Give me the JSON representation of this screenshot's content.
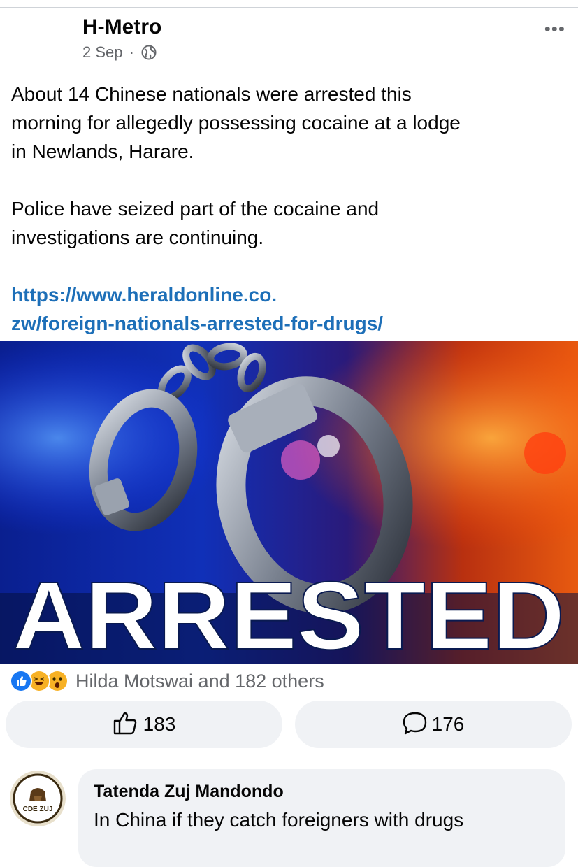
{
  "post": {
    "author": "H-Metro",
    "date": "2 Sep",
    "separator": "·",
    "privacy_icon": "globe-icon",
    "more_label": "•••",
    "text_lines": [
      "About 14 Chinese nationals were arrested this",
      "morning for allegedly possessing cocaine at a lodge",
      "in Newlands, Harare."
    ],
    "text_lines_2": [
      "Police have seized part of the cocaine and",
      "investigations are continuing."
    ],
    "link_lines": [
      "https://www.heraldonline.co.",
      "zw/foreign-nationals-arrested-for-drugs/"
    ],
    "image_caption": "ARRESTED"
  },
  "reactions": {
    "icons": [
      "like-icon",
      "haha-icon",
      "wow-icon"
    ],
    "summary": "Hilda Motswai and 182 others"
  },
  "actions": {
    "like_count": "183",
    "comment_count": "176"
  },
  "comment": {
    "avatar_text": "CDE ZUJ",
    "author": "Tatenda Zuj Mandondo",
    "text": "In China if they catch foreigners with drugs"
  },
  "colors": {
    "link": "#1d6fb8",
    "secondary_text": "#65676b",
    "button_bg": "#f0f2f5",
    "like_blue": "#1877f2"
  }
}
